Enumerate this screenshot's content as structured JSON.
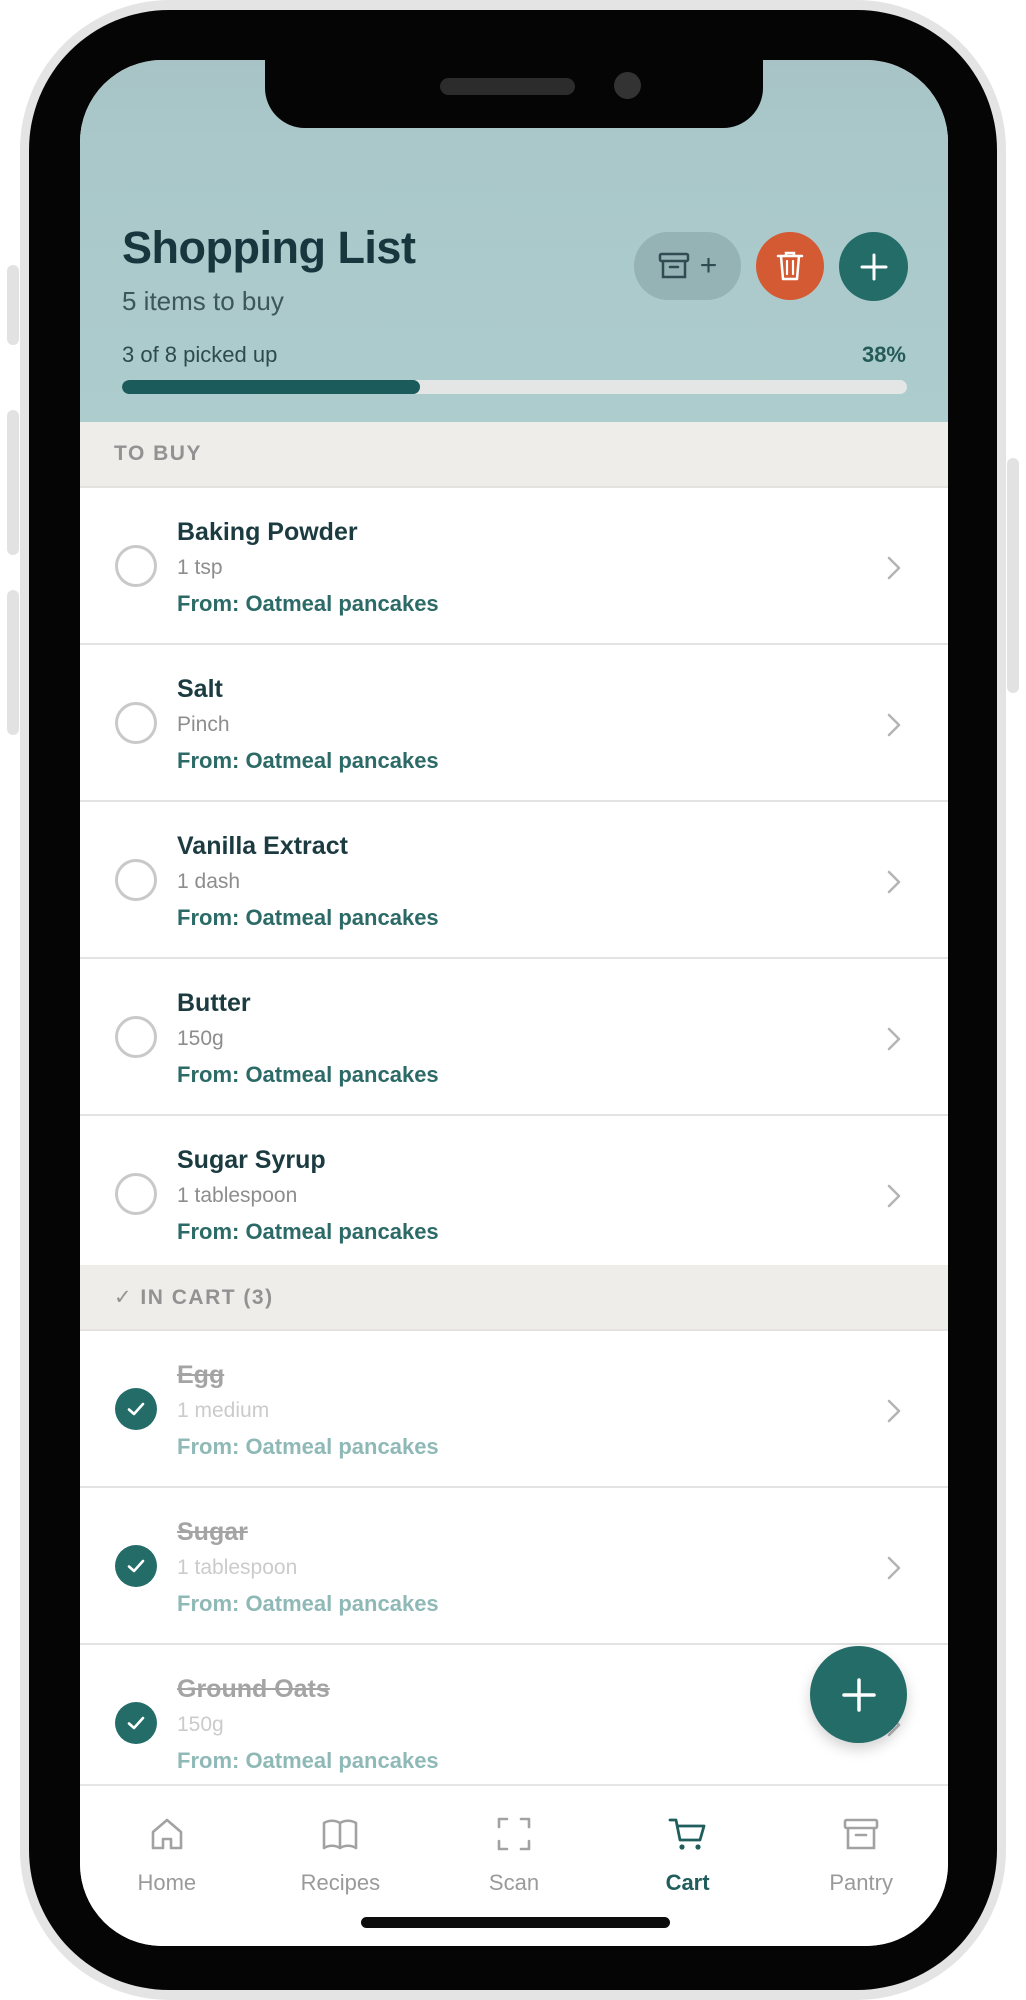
{
  "header": {
    "title": "Shopping List",
    "subtitle": "5 items to buy",
    "progress_label": "3 of 8 picked up",
    "progress_percent_label": "38%",
    "progress_value": 0.38,
    "archive_plus": "+"
  },
  "sections": {
    "to_buy": "TO BUY",
    "in_cart": "✓ IN CART (3)"
  },
  "to_buy_items": [
    {
      "name": "Baking Powder",
      "qty": "1 tsp",
      "from": "From: Oatmeal pancakes"
    },
    {
      "name": "Salt",
      "qty": "Pinch",
      "from": "From: Oatmeal pancakes"
    },
    {
      "name": "Vanilla Extract",
      "qty": "1 dash",
      "from": "From: Oatmeal pancakes"
    },
    {
      "name": "Butter",
      "qty": "150g",
      "from": "From: Oatmeal pancakes"
    },
    {
      "name": "Sugar Syrup",
      "qty": "1 tablespoon",
      "from": "From: Oatmeal pancakes"
    }
  ],
  "in_cart_items": [
    {
      "name": "Egg",
      "qty": "1 medium",
      "from": "From: Oatmeal pancakes"
    },
    {
      "name": "Sugar",
      "qty": "1 tablespoon",
      "from": "From: Oatmeal pancakes"
    },
    {
      "name": "Ground Oats",
      "qty": "150g",
      "from": "From: Oatmeal pancakes"
    }
  ],
  "tabs": [
    {
      "label": "Home",
      "icon": "home-icon"
    },
    {
      "label": "Recipes",
      "icon": "book-icon"
    },
    {
      "label": "Scan",
      "icon": "scan-icon"
    },
    {
      "label": "Cart",
      "icon": "cart-icon",
      "active": true
    },
    {
      "label": "Pantry",
      "icon": "archive-icon"
    }
  ],
  "colors": {
    "accent": "#246c68",
    "danger": "#d45a33",
    "header_bg": "#adcccd"
  }
}
